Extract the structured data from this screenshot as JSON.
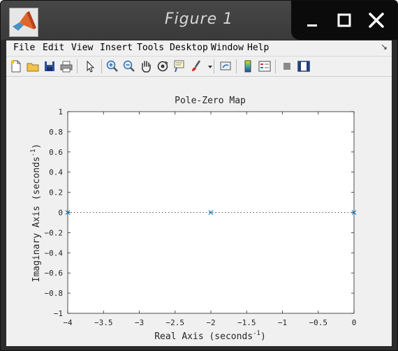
{
  "window": {
    "title": "Figure 1"
  },
  "menu": [
    "File",
    "Edit",
    "View",
    "Insert",
    "Tools",
    "Desktop",
    "Window",
    "Help"
  ],
  "toolbar": [
    "new-figure",
    "open-file",
    "save",
    "print",
    "edit-plot",
    "zoom-in",
    "zoom-out",
    "pan",
    "rotate-3d",
    "data-cursor",
    "brush",
    "brush-dropdown",
    "link-plot",
    "insert-colorbar",
    "insert-legend",
    "hide-plot-tools",
    "show-plot-tools"
  ],
  "chart_data": {
    "type": "scatter",
    "title": "Pole-Zero Map",
    "xlabel": "Real Axis (seconds",
    "xlabel_sup": "-1",
    "xlabel_end": ")",
    "ylabel": "Imaginary Axis (seconds",
    "ylabel_sup": "-1",
    "ylabel_end": ")",
    "xlim": [
      -4,
      0
    ],
    "ylim": [
      -1,
      1
    ],
    "xticks": [
      "-4",
      "-3.5",
      "-3",
      "-2.5",
      "-2",
      "-1.5",
      "-1",
      "-0.5",
      "0"
    ],
    "yticks": [
      "-1",
      "-0.8",
      "-0.6",
      "-0.4",
      "-0.2",
      "0",
      "0.2",
      "0.4",
      "0.6",
      "0.8",
      "1"
    ],
    "poles": [
      {
        "x": -4,
        "y": 0
      },
      {
        "x": -2,
        "y": 0
      },
      {
        "x": 0,
        "y": 0
      }
    ],
    "marker_color": "#0072bd",
    "grid": false
  }
}
